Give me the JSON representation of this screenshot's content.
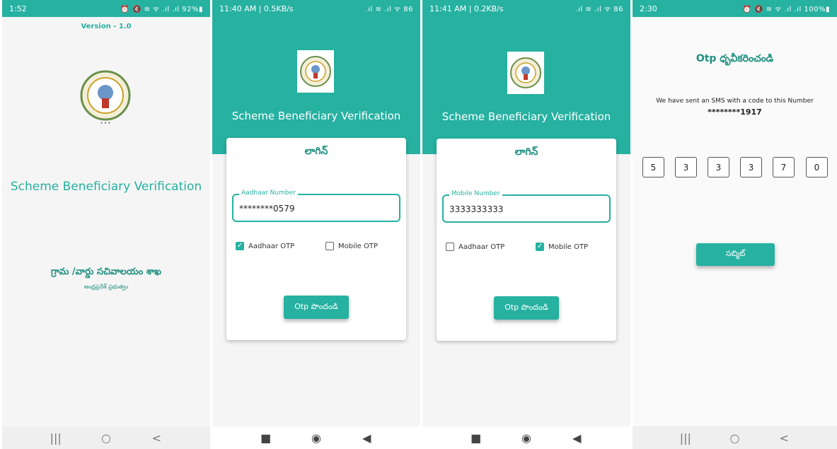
{
  "screen1": {
    "status_time": "1:52",
    "status_right": "⏰ 🔇 ≋ ᯤ .ıl .ıl 92%▮",
    "version": "Version - 1.0",
    "app_title": "Scheme Beneficiary Verification",
    "department": "గ్రామ /వార్డు సచివాలయం శాఖ",
    "government": "ఆంధ్రప్రదేశ్ ప్రభుత్వం",
    "nav": [
      "|||",
      "○",
      "<"
    ]
  },
  "screen2": {
    "status_time": "11:40 AM | 0.5KB/s",
    "status_right": ".ıl ≋ .ıl ᯤ 86",
    "app_title": "Scheme Beneficiary Verification",
    "card_title": "లాగిన్",
    "field_label": "Aadhaar Number",
    "field_value": "********0579",
    "checkbox_aadhaar": "Aadhaar OTP",
    "checkbox_mobile": "Mobile OTP",
    "aadhaar_checked": true,
    "mobile_checked": false,
    "button_label": "Otp పొందండి",
    "nav": [
      "■",
      "◉",
      "◀"
    ]
  },
  "screen3": {
    "status_time": "11:41 AM | 0.2KB/s",
    "status_right": ".ıl ≋ .ıl ᯤ 86",
    "app_title": "Scheme Beneficiary Verification",
    "card_title": "లాగిన్",
    "field_label": "Mobile Number",
    "field_value": "3333333333",
    "checkbox_aadhaar": "Aadhaar OTP",
    "checkbox_mobile": "Mobile OTP",
    "aadhaar_checked": false,
    "mobile_checked": true,
    "button_label": "Otp పొందండి",
    "nav": [
      "■",
      "◉",
      "◀"
    ]
  },
  "screen4": {
    "status_time": "2:30",
    "status_right": "⏰ 🔇 ≋ ᯤ .ıl .ıl 100%▮",
    "title": "Otp ధృవీకరించండి",
    "message": "We have sent an SMS with a code to this Number",
    "masked_number": "********1917",
    "otp_digits": [
      "5",
      "3",
      "3",
      "3",
      "7",
      "0"
    ],
    "submit_label": "సబ్మిట్",
    "nav": [
      "|||",
      "○",
      "<"
    ]
  },
  "colors": {
    "accent": "#26b1a1",
    "accent_dark": "#1f8f82"
  },
  "icons": [
    "ap-emblem-icon",
    "checkmark-icon",
    "recents-icon",
    "home-icon",
    "back-icon"
  ]
}
